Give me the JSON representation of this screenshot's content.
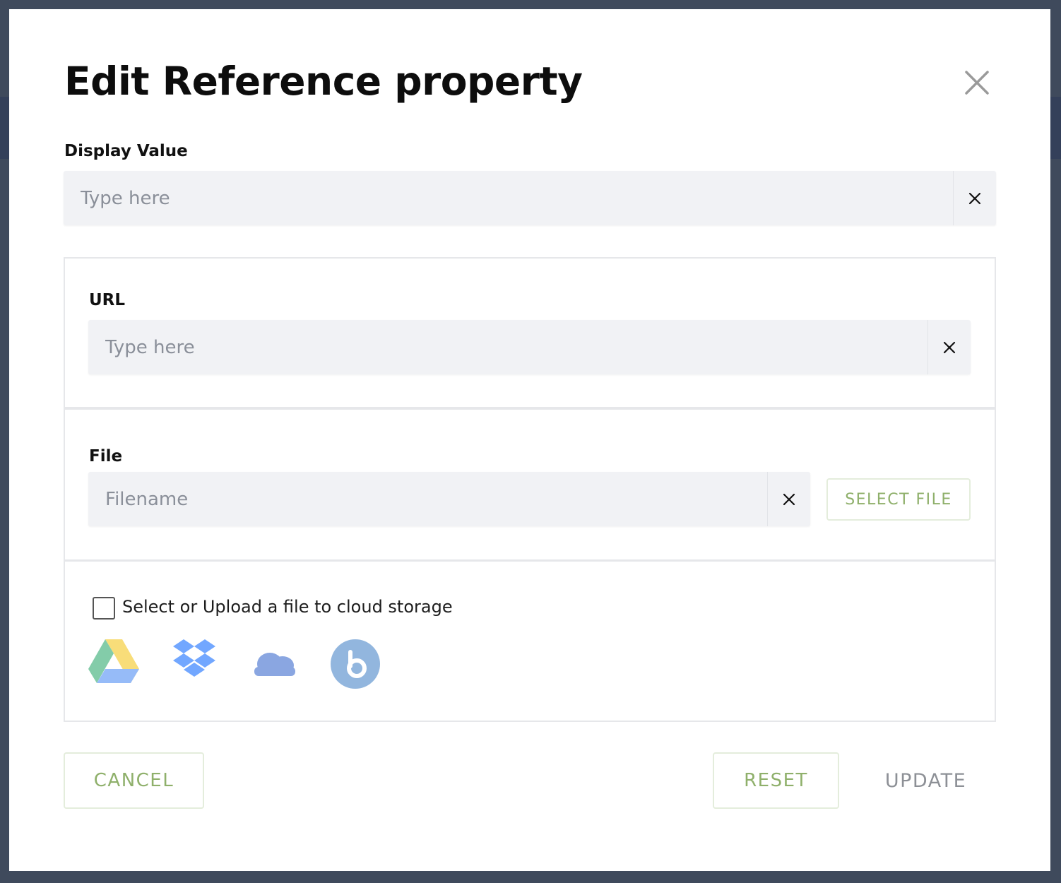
{
  "dialog": {
    "title": "Edit Reference property",
    "close_icon": "close-icon"
  },
  "display_value": {
    "label": "Display Value",
    "placeholder": "Type here",
    "value": ""
  },
  "url": {
    "label": "URL",
    "placeholder": "Type here",
    "value": ""
  },
  "file": {
    "label": "File",
    "placeholder": "Filename",
    "value": "",
    "select_button": "SELECT FILE"
  },
  "cloud": {
    "checkbox_label": "Select or Upload a file to cloud storage",
    "checked": false,
    "providers": [
      "google-drive-icon",
      "dropbox-icon",
      "onedrive-icon",
      "box-icon"
    ]
  },
  "actions": {
    "cancel": "CANCEL",
    "reset": "RESET",
    "update": "UPDATE"
  },
  "colors": {
    "accent_green": "#8fb06b",
    "input_bg": "#f1f2f5",
    "overlay": "#3f4a5c"
  }
}
